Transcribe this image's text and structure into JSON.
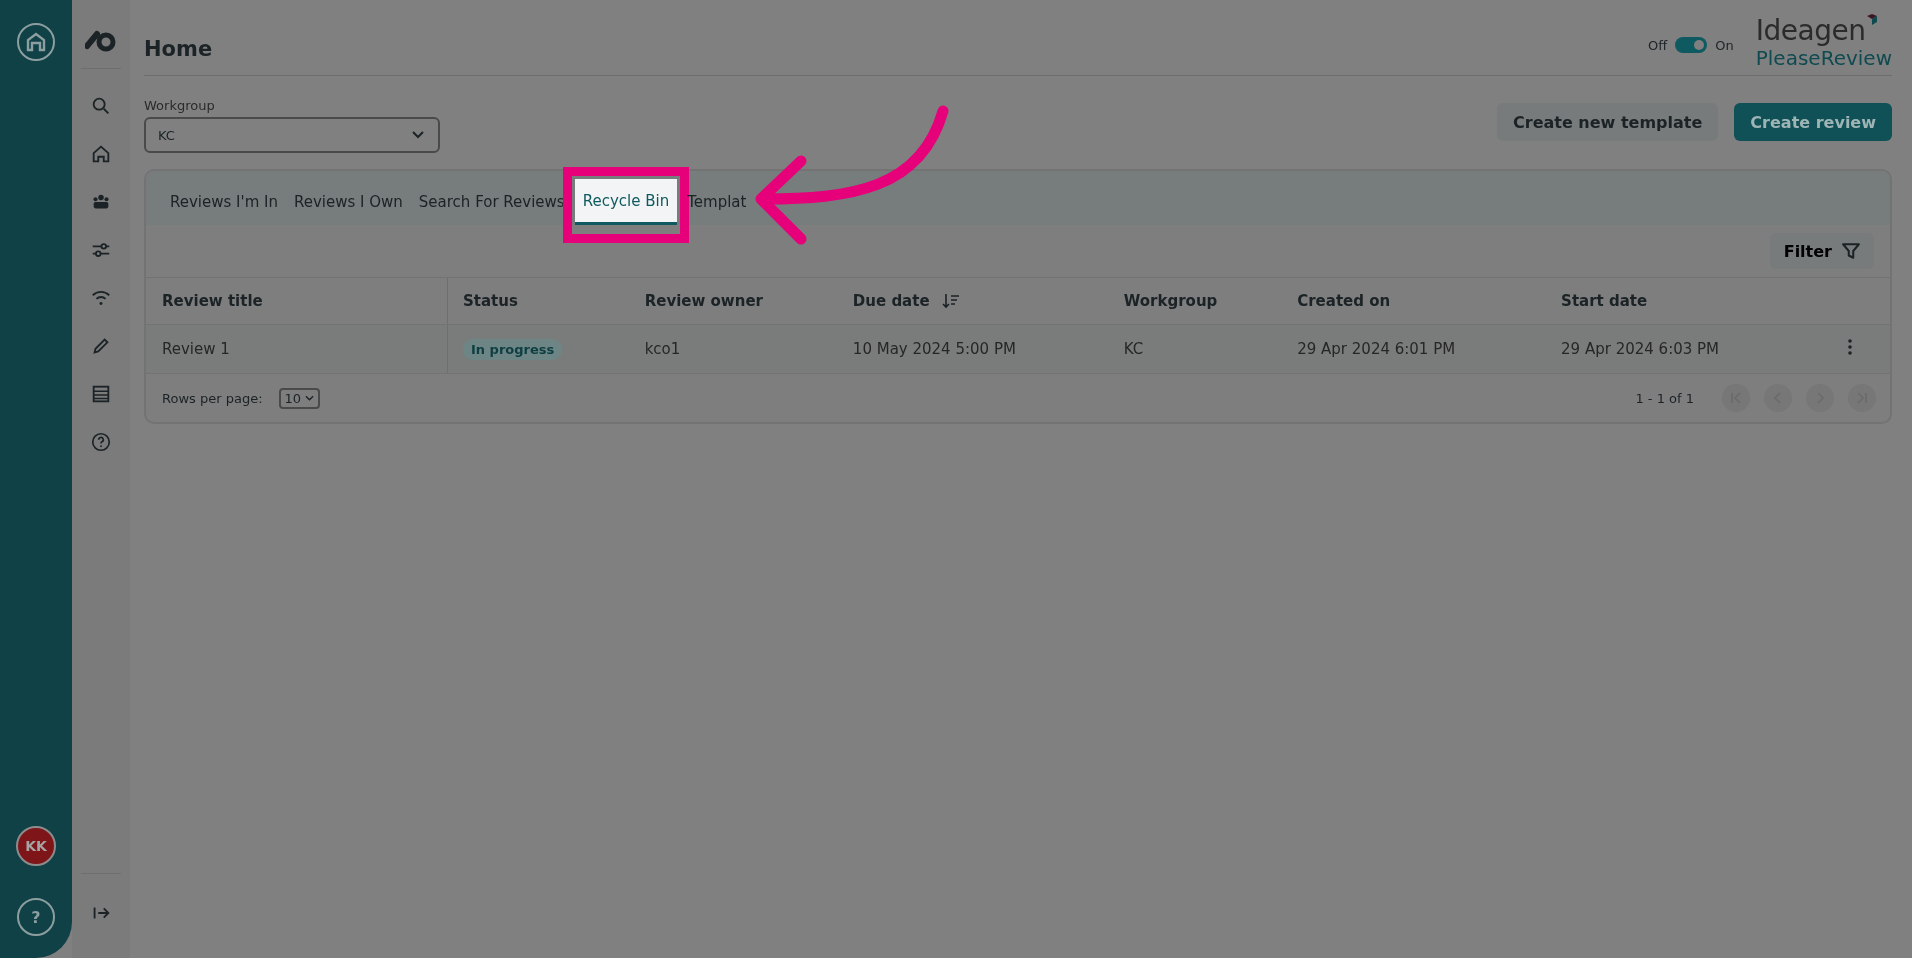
{
  "rail": {
    "avatar": "KK",
    "help": "?"
  },
  "page": {
    "title": "Home"
  },
  "view_toggle": {
    "off_label": "Off",
    "on_label": "On",
    "on": true
  },
  "brand": {
    "line_1": "Ideagen",
    "line_2": "PleaseReview"
  },
  "workgroup": {
    "label": "Workgroup",
    "value": "KC"
  },
  "buttons": [
    {
      "label": "Create new template",
      "kind": "secondary"
    },
    {
      "label": "Create review",
      "kind": "primary"
    }
  ],
  "tabs": [
    {
      "label": "Reviews I'm In",
      "selected": false
    },
    {
      "label": "Reviews I Own",
      "selected": false
    },
    {
      "label": "Search For Reviews",
      "selected": false
    },
    {
      "label": "Recycle Bin",
      "selected": true
    },
    {
      "label": "Templat",
      "selected": false
    }
  ],
  "filter": {
    "label": "Filter"
  },
  "table": {
    "columns": [
      {
        "label": "Review title",
        "sorted": false
      },
      {
        "label": "Status",
        "sorted": false
      },
      {
        "label": "Review owner",
        "sorted": false
      },
      {
        "label": "Due date",
        "sorted": true
      },
      {
        "label": "Workgroup",
        "sorted": false
      },
      {
        "label": "Created on",
        "sorted": false
      },
      {
        "label": "Start date",
        "sorted": false
      }
    ],
    "rows": [
      {
        "cells": [
          "Review 1",
          "In progress",
          "kco1",
          "10 May 2024 5:00 PM",
          "KC",
          "29 Apr 2024 6:01 PM",
          "29 Apr 2024 6:03 PM"
        ]
      }
    ]
  },
  "pagination": {
    "rows_per_page_label": "Rows per page:",
    "rows_per_page": "10",
    "range": "1 - 1 of 1"
  }
}
